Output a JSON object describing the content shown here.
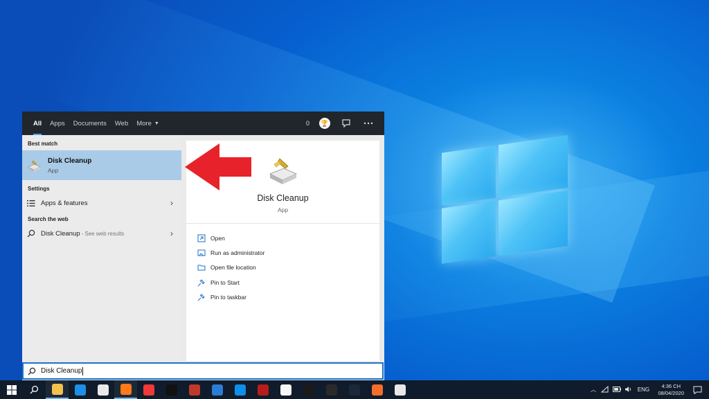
{
  "search_panel": {
    "tabs": [
      {
        "label": "All",
        "active": true
      },
      {
        "label": "Apps"
      },
      {
        "label": "Documents"
      },
      {
        "label": "Web"
      },
      {
        "label": "More"
      }
    ],
    "points": "0",
    "sections": {
      "best_match": "Best match",
      "settings": "Settings",
      "search_web": "Search the web"
    },
    "best_match": {
      "name": "Disk Cleanup",
      "type": "App"
    },
    "settings_item": "Apps & features",
    "web_item": {
      "query": "Disk Cleanup",
      "hint": "- See web results"
    },
    "preview": {
      "name": "Disk Cleanup",
      "type": "App"
    },
    "actions": [
      "Open",
      "Run as administrator",
      "Open file location",
      "Pin to Start",
      "Pin to taskbar"
    ],
    "search_value": "Disk Cleanup"
  },
  "taskbar": {
    "apps": [
      {
        "icon": "file-explorer-icon",
        "color": "#f2c14e",
        "on": true
      },
      {
        "icon": "mail-icon",
        "color": "#1f8fe6",
        "on": false
      },
      {
        "icon": "paint-icon",
        "color": "#e9e9e9",
        "on": false
      },
      {
        "icon": "firefox-icon",
        "color": "#ff7a1a",
        "on": true
      },
      {
        "icon": "vivaldi-icon",
        "color": "#ef3939",
        "on": false
      },
      {
        "icon": "record-icon",
        "color": "#111111",
        "on": false
      },
      {
        "icon": "ccleaner-icon",
        "color": "#c0392b",
        "on": false
      },
      {
        "icon": "word-icon",
        "color": "#2b7cd3",
        "on": false
      },
      {
        "icon": "teamviewer-icon",
        "color": "#0e8ee9",
        "on": false
      },
      {
        "icon": "sw-icon",
        "color": "#b71c1c",
        "on": false
      },
      {
        "icon": "apps-icon",
        "color": "#f5f5f5",
        "on": false
      },
      {
        "icon": "game-icon",
        "color": "#1a1a1a",
        "on": false
      },
      {
        "icon": "epic-games-icon",
        "color": "#2a2a2a",
        "on": false
      },
      {
        "icon": "steam-icon",
        "color": "#1b2838",
        "on": false
      },
      {
        "icon": "origin-icon",
        "color": "#f56c2d",
        "on": false
      },
      {
        "icon": "chrome-icon",
        "color": "#e8e8e8",
        "on": false
      }
    ],
    "language": "ENG",
    "time": "4:36 CH",
    "date": "08/04/2020"
  }
}
